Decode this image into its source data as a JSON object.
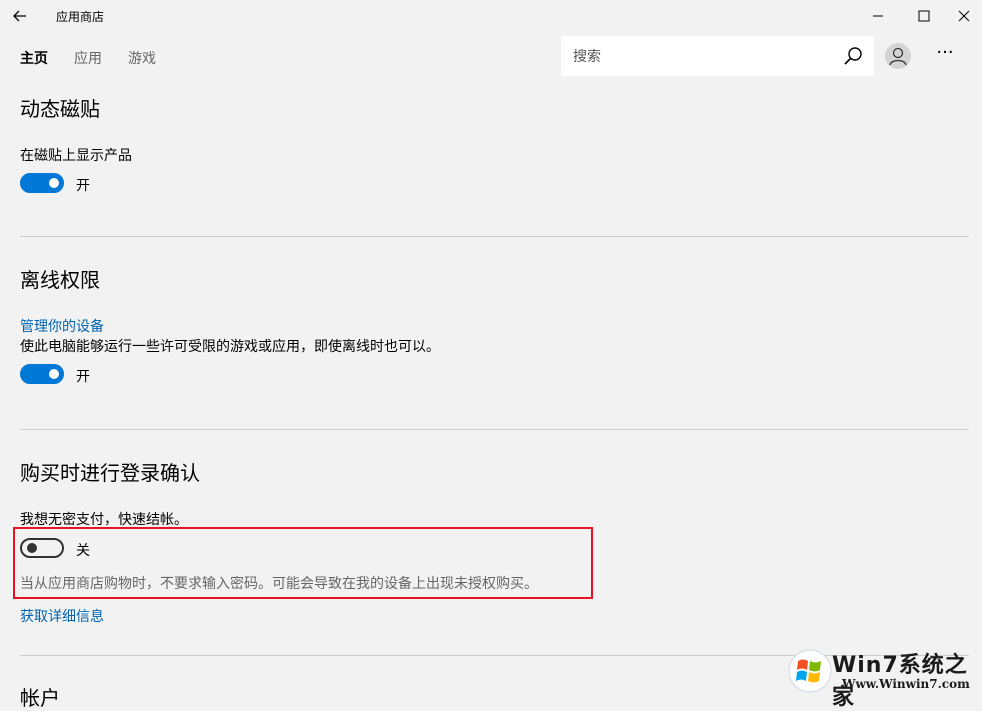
{
  "window": {
    "title": "应用商店",
    "controls": [
      "minimize-icon",
      "maximize-icon",
      "close-icon"
    ]
  },
  "nav": {
    "tabs": [
      {
        "label": "主页",
        "active": true
      },
      {
        "label": "应用",
        "active": false
      },
      {
        "label": "游戏",
        "active": false
      }
    ],
    "search_placeholder": "搜索",
    "more_label": "···"
  },
  "sections": {
    "live_tile": {
      "heading": "动态磁贴",
      "label": "在磁贴上显示产品",
      "toggle_on": true,
      "toggle_state": "开"
    },
    "offline": {
      "heading": "离线权限",
      "link": "管理你的设备",
      "desc": "使此电脑能够运行一些许可受限的游戏或应用，即使离线时也可以。",
      "toggle_on": true,
      "toggle_state": "开"
    },
    "purchase": {
      "heading": "购买时进行登录确认",
      "label": "我想无密支付，快速结帐。",
      "toggle_on": false,
      "toggle_state": "关",
      "desc": "当从应用商店购物时，不要求输入密码。可能会导致在我的设备上出现未授权购买。",
      "link": "获取详细信息"
    },
    "account": {
      "heading": "帐户"
    }
  },
  "watermark": {
    "title": "Win7系统之家",
    "site": "Www.Winwin7.com"
  },
  "colors": {
    "accent": "#0078d7",
    "link": "#0063b1",
    "highlight": "#e81123",
    "background": "#f2f2f2"
  }
}
